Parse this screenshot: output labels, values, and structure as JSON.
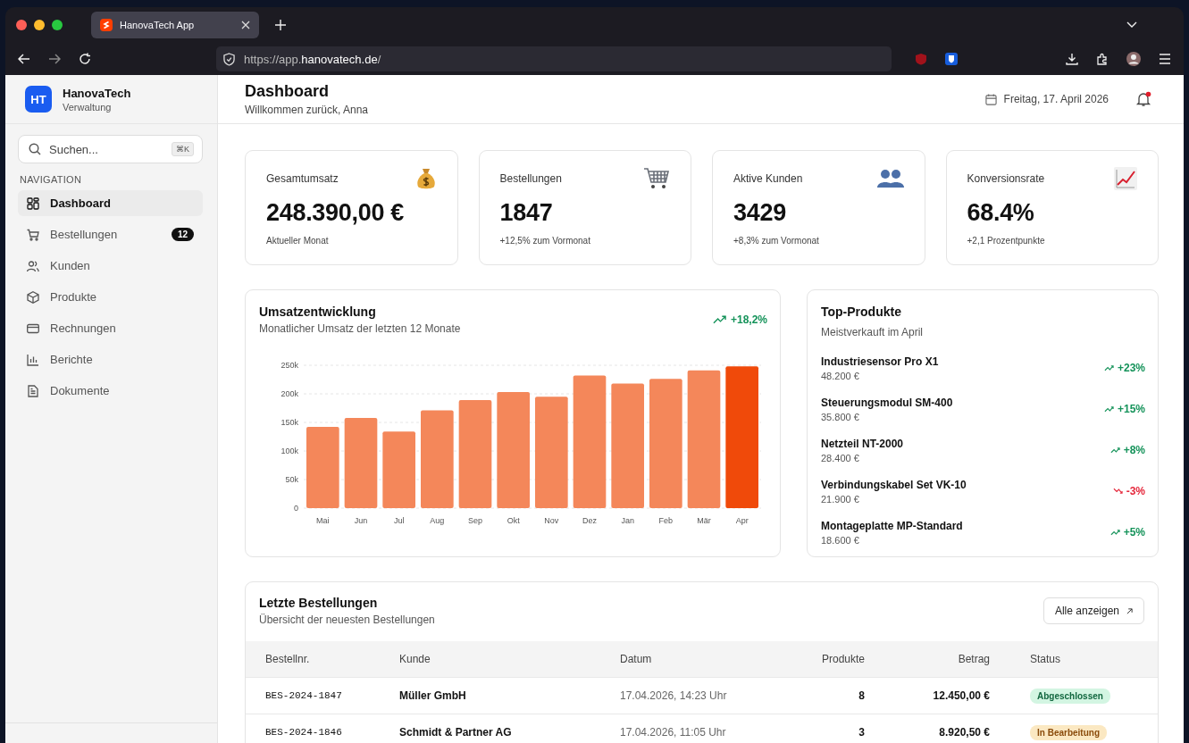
{
  "browser": {
    "tab_title": "HanovaTech App",
    "url": "https://app.**hanovatech.de**/"
  },
  "sidebar": {
    "brand": {
      "initials": "HT",
      "name": "HanovaTech",
      "subtitle": "Verwaltung"
    },
    "search": {
      "placeholder": "Suchen...",
      "shortcut": "⌘K"
    },
    "section_label": "NAVIGATION",
    "items": [
      {
        "label": "Dashboard",
        "selected": true
      },
      {
        "label": "Bestellungen",
        "selected": false,
        "badge": "12"
      },
      {
        "label": "Kunden",
        "selected": false
      },
      {
        "label": "Produkte",
        "selected": false
      },
      {
        "label": "Rechnungen",
        "selected": false
      },
      {
        "label": "Berichte",
        "selected": false
      },
      {
        "label": "Dokumente",
        "selected": false
      }
    ]
  },
  "header": {
    "title": "Dashboard",
    "subtitle": "Willkommen zurück, Anna",
    "date": "Freitag, 17. April 2026",
    "unread_notifications": true
  },
  "stats": [
    {
      "label": "Gesamtumsatz",
      "value": "248.390,00 €",
      "note": "Aktueller Monat"
    },
    {
      "label": "Bestellungen",
      "value": "1847",
      "note": "+12,5% zum Vormonat"
    },
    {
      "label": "Aktive Kunden",
      "value": "3429",
      "note": "+8,3% zum Vormonat"
    },
    {
      "label": "Konversionsrate",
      "value": "68.4%",
      "note": "+2,1 Prozentpunkte"
    }
  ],
  "revenue": {
    "title": "Umsatzentwicklung",
    "subtitle": "Monatlicher Umsatz der letzten 12 Monate",
    "change": "+18,2%",
    "chart_data": {
      "type": "bar",
      "stacked": true,
      "grid": true,
      "categories": [
        "Mai",
        "Jun",
        "Jul",
        "Aug",
        "Sep",
        "Okt",
        "Nov",
        "Dez",
        "Jan",
        "Feb",
        "Mär",
        "Apr"
      ],
      "series": [
        {
          "color": "#f4875a",
          "values": [
            142000,
            158000,
            134000,
            171000,
            189000,
            203000,
            195000,
            232000,
            218000,
            226000,
            241000,
            null
          ]
        },
        {
          "color": "#f04a0a",
          "values": [
            null,
            null,
            null,
            null,
            null,
            null,
            null,
            null,
            null,
            null,
            null,
            248000
          ]
        }
      ],
      "ylim": [
        0,
        250000
      ],
      "yticks": [
        {
          "value": 0,
          "label": "0"
        },
        {
          "value": 50000,
          "label": "50k"
        },
        {
          "value": 100000,
          "label": "100k"
        },
        {
          "value": 150000,
          "label": "150k"
        },
        {
          "value": 200000,
          "label": "200k"
        },
        {
          "value": 250000,
          "label": "250k"
        }
      ]
    }
  },
  "top_products": {
    "title": "Top-Produkte",
    "subtitle": "Meistverkauft im April",
    "items": [
      {
        "name": "Industriesensor Pro X1",
        "revenue": "48.200 €",
        "change": "+23%",
        "kind": "up"
      },
      {
        "name": "Steuerungsmodul SM-400",
        "revenue": "35.800 €",
        "change": "+15%",
        "kind": "up"
      },
      {
        "name": "Netzteil NT-2000",
        "revenue": "28.400 €",
        "change": "+8%",
        "kind": "up"
      },
      {
        "name": "Verbindungskabel Set VK-10",
        "revenue": "21.900 €",
        "change": "-3%",
        "kind": "down"
      },
      {
        "name": "Montageplatte MP-Standard",
        "revenue": "18.600 €",
        "change": "+5%",
        "kind": "up"
      }
    ]
  },
  "orders": {
    "title": "Letzte Bestellungen",
    "subtitle": "Übersicht der neuesten Bestellungen",
    "button": "Alle anzeigen",
    "columns": [
      "Bestellnr.",
      "Kunde",
      "Datum",
      "Produkte",
      "Betrag",
      "Status"
    ],
    "rows": [
      {
        "id": "BES-2024-1847",
        "customer": "Müller GmbH",
        "date": "17.04.2026, 14:23 Uhr",
        "products": "8",
        "amount": "12.450,00 €",
        "status": "Abgeschlossen",
        "kind": "done"
      },
      {
        "id": "BES-2024-1846",
        "customer": "Schmidt & Partner AG",
        "date": "17.04.2026, 11:05 Uhr",
        "products": "3",
        "amount": "8.920,50 €",
        "status": "In Bearbeitung",
        "kind": "progress"
      }
    ]
  }
}
